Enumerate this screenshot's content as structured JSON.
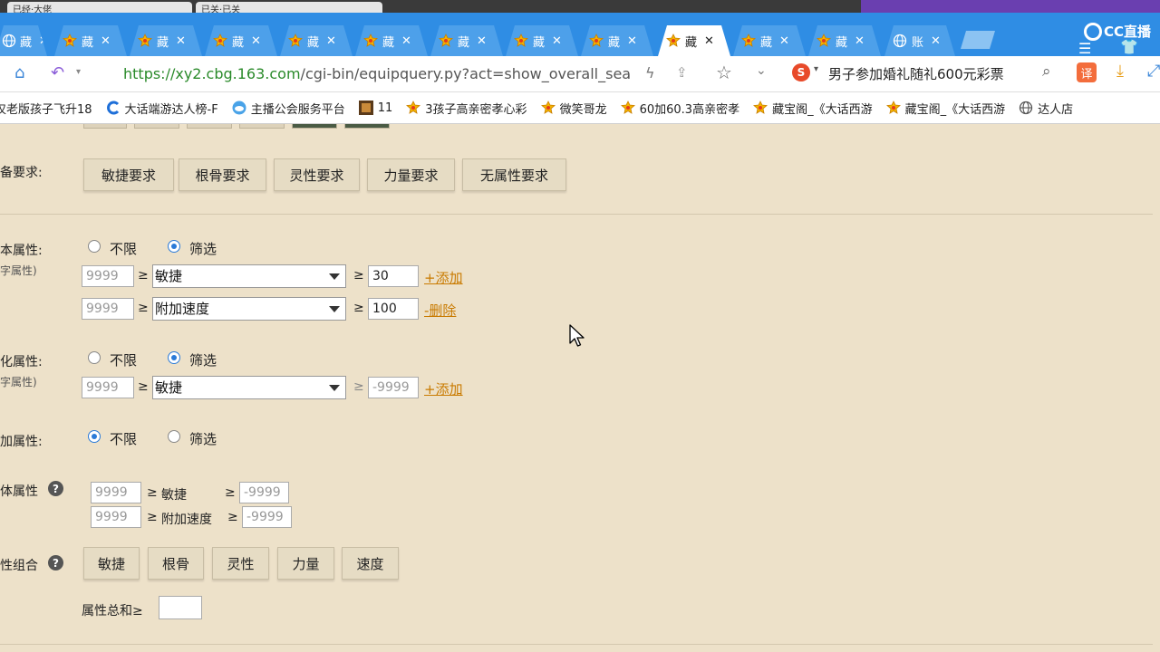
{
  "os_strip": {
    "tab1": "已经·大佬",
    "tab2": "已关·已关"
  },
  "tabs": [
    {
      "label": "藏",
      "icon": "globe-icon",
      "active": false
    },
    {
      "label": "藏",
      "icon": "cbg-icon",
      "active": false
    },
    {
      "label": "藏",
      "icon": "cbg-icon",
      "active": false
    },
    {
      "label": "藏",
      "icon": "cbg-icon",
      "active": false
    },
    {
      "label": "藏",
      "icon": "cbg-icon",
      "active": false
    },
    {
      "label": "藏",
      "icon": "cbg-icon",
      "active": false
    },
    {
      "label": "藏",
      "icon": "cbg-icon",
      "active": false
    },
    {
      "label": "藏",
      "icon": "cbg-icon",
      "active": false
    },
    {
      "label": "藏",
      "icon": "cbg-icon",
      "active": false
    },
    {
      "label": "藏",
      "icon": "cbg-icon",
      "active": true
    },
    {
      "label": "藏",
      "icon": "cbg-icon",
      "active": false
    },
    {
      "label": "藏",
      "icon": "cbg-icon",
      "active": false
    },
    {
      "label": "账",
      "icon": "globe-icon",
      "active": false
    }
  ],
  "tab_close": "✕",
  "overlay": {
    "brand": "CC直播"
  },
  "address": {
    "url_green": "https://xy2.cbg.163.com",
    "url_gray": "/cgi-bin/equipquery.py?act=show_overall_sea",
    "search_text": "男子参加婚礼随礼600元彩票",
    "translate_label": "译"
  },
  "bookmarks": [
    {
      "label": "仅老版孩子飞升18",
      "icon": "none"
    },
    {
      "label": "大话端游达人榜-F",
      "icon": "c-icon"
    },
    {
      "label": "主播公会服务平台",
      "icon": "cloud-icon"
    },
    {
      "label": "11",
      "icon": "game-icon"
    },
    {
      "label": "3孩子高亲密孝心彩",
      "icon": "cbg-icon"
    },
    {
      "label": "微笑哥龙",
      "icon": "cbg-icon"
    },
    {
      "label": "60加60.3高亲密孝",
      "icon": "cbg-icon"
    },
    {
      "label": "藏宝阁_《大话西游",
      "icon": "cbg-icon"
    },
    {
      "label": "藏宝阁_《大话西游",
      "icon": "cbg-icon"
    },
    {
      "label": "达人店",
      "icon": "globe-icon"
    }
  ],
  "form": {
    "equip_req": {
      "label": "备要求:",
      "buttons": [
        "敏捷要求",
        "根骨要求",
        "灵性要求",
        "力量要求",
        "无属性要求"
      ]
    },
    "base_attr": {
      "label": "本属性:",
      "sublabel": "字属性)",
      "opt_unlimited": "不限",
      "opt_filter": "筛选",
      "selected": "筛选",
      "rows": [
        {
          "min_placeholder": "9999",
          "attr": "敏捷",
          "value": "30",
          "action": "+添加"
        },
        {
          "min_placeholder": "9999",
          "attr": "附加速度",
          "value": "100",
          "action": "-删除"
        }
      ]
    },
    "refine_attr": {
      "label": "化属性:",
      "sublabel": "字属性)",
      "opt_unlimited": "不限",
      "opt_filter": "筛选",
      "selected": "筛选",
      "rows": [
        {
          "min_placeholder": "9999",
          "attr": "敏捷",
          "value_placeholder": "-9999",
          "action": "+添加"
        }
      ]
    },
    "extra_attr": {
      "label": "加属性:",
      "opt_unlimited": "不限",
      "opt_filter": "筛选",
      "selected": "不限"
    },
    "total_attr": {
      "label": "体属性",
      "rows": [
        {
          "min_placeholder": "9999",
          "name": "敏捷",
          "value_placeholder": "-9999"
        },
        {
          "min_placeholder": "9999",
          "name": "附加速度",
          "value_placeholder": "-9999"
        }
      ]
    },
    "attr_combo": {
      "label": "性组合",
      "buttons": [
        "敏捷",
        "根骨",
        "灵性",
        "力量",
        "速度"
      ],
      "sum_label": "属性总和≥"
    },
    "ge": "≥"
  }
}
